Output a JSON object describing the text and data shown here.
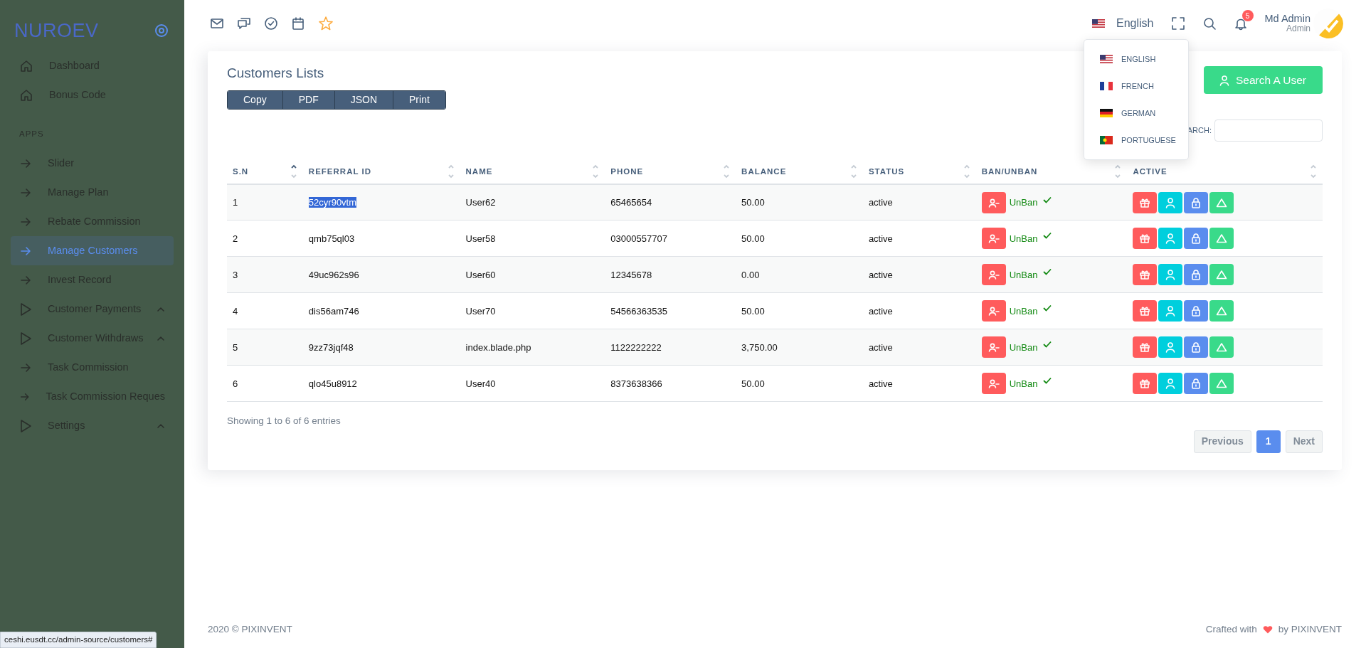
{
  "sidebar": {
    "brand": "NUROEV",
    "items": [
      {
        "kind": "home",
        "label": "Dashboard",
        "selected": false,
        "submenu": false
      },
      {
        "kind": "home",
        "label": "Bonus Code",
        "selected": false,
        "submenu": false
      }
    ],
    "section": {
      "title": "APPS",
      "items": [
        {
          "kind": "arrow",
          "label": "Slider",
          "selected": false,
          "submenu": false
        },
        {
          "kind": "arrow",
          "label": "Manage Plan",
          "selected": false,
          "submenu": false
        },
        {
          "kind": "arrow",
          "label": "Rebate Commission",
          "selected": false,
          "submenu": false
        },
        {
          "kind": "arrow",
          "label": "Manage Customers",
          "selected": true,
          "submenu": false
        },
        {
          "kind": "arrow",
          "label": "Invest Record",
          "selected": false,
          "submenu": false
        },
        {
          "kind": "play",
          "label": "Customer Payments",
          "selected": false,
          "submenu": true
        },
        {
          "kind": "play",
          "label": "Customer Withdraws",
          "selected": false,
          "submenu": true
        },
        {
          "kind": "arrow",
          "label": "Task Commission",
          "selected": false,
          "submenu": false
        },
        {
          "kind": "arrow",
          "label": "Task Commission Reques",
          "selected": false,
          "submenu": false
        },
        {
          "kind": "play",
          "label": "Settings",
          "selected": false,
          "submenu": true
        }
      ]
    }
  },
  "topbar": {
    "shortcuts": [
      {
        "kind": "mail"
      },
      {
        "kind": "chat"
      },
      {
        "kind": "check"
      },
      {
        "kind": "calendar"
      },
      {
        "kind": "star"
      }
    ],
    "language": {
      "kind": "us",
      "label": "English"
    },
    "notification_count": "5",
    "user": {
      "name": "Md Admin",
      "role": "Admin"
    }
  },
  "language_menu": [
    {
      "kind": "us",
      "label": "ENGLISH"
    },
    {
      "kind": "fr",
      "label": "FRENCH"
    },
    {
      "kind": "de",
      "label": "GERMAN"
    },
    {
      "kind": "pt",
      "label": "PORTUGUESE"
    }
  ],
  "card": {
    "title": "Customers Lists",
    "export_buttons": [
      "Copy",
      "PDF",
      "JSON",
      "Print"
    ],
    "search_button": "Search A User",
    "search_label": "ARCH:",
    "table": {
      "columns": [
        {
          "label": "S.N",
          "sorted": true
        },
        {
          "label": "REFERRAL ID",
          "sorted": false
        },
        {
          "label": "NAME",
          "sorted": false
        },
        {
          "label": "PHONE",
          "sorted": false
        },
        {
          "label": "BALANCE",
          "sorted": false
        },
        {
          "label": "STATUS",
          "sorted": false
        },
        {
          "label": "BAN/UNBAN",
          "sorted": false
        },
        {
          "label": "ACTIVE",
          "sorted": false
        }
      ],
      "action_buttons": [
        {
          "kind": "gift",
          "color": "#ff5b5c"
        },
        {
          "kind": "user",
          "color": "#00cfdd"
        },
        {
          "kind": "lock",
          "color": "#5a8dee"
        },
        {
          "kind": "triangle",
          "color": "#39da8a"
        }
      ],
      "rows": [
        {
          "sn": "1",
          "referral_id": "52cyr90vtm",
          "referral_highlighted": true,
          "name": "User62",
          "phone": "65465654",
          "balance": "50.00",
          "status": "active",
          "ban_label": "UnBan"
        },
        {
          "sn": "2",
          "referral_id": "qmb75ql03",
          "referral_highlighted": false,
          "name": "User58",
          "phone": "03000557707",
          "balance": "50.00",
          "status": "active",
          "ban_label": "UnBan"
        },
        {
          "sn": "3",
          "referral_id": "49uc962s96",
          "referral_highlighted": false,
          "name": "User60",
          "phone": "12345678",
          "balance": "0.00",
          "status": "active",
          "ban_label": "UnBan"
        },
        {
          "sn": "4",
          "referral_id": "dis56am746",
          "referral_highlighted": false,
          "name": "User70",
          "phone": "54566363535",
          "balance": "50.00",
          "status": "active",
          "ban_label": "UnBan"
        },
        {
          "sn": "5",
          "referral_id": "9zz73jqf48",
          "referral_highlighted": false,
          "name": "index.blade.php",
          "phone": "1122222222",
          "balance": "3,750.00",
          "status": "active",
          "ban_label": "UnBan"
        },
        {
          "sn": "6",
          "referral_id": "qlo45u8912",
          "referral_highlighted": false,
          "name": "User40",
          "phone": "8373638366",
          "balance": "50.00",
          "status": "active",
          "ban_label": "UnBan"
        }
      ]
    },
    "info": "Showing 1 to 6 of 6 entries",
    "pagination": [
      {
        "label": "Previous",
        "selected": false
      },
      {
        "label": "1",
        "selected": true
      },
      {
        "label": "Next",
        "selected": false
      }
    ]
  },
  "footer": {
    "left": "2020 © PIXINVENT",
    "right_before": "Crafted with",
    "right_after": "by PIXINVENT"
  },
  "status_url": "ceshi.eusdt.cc/admin-source/customers#"
}
